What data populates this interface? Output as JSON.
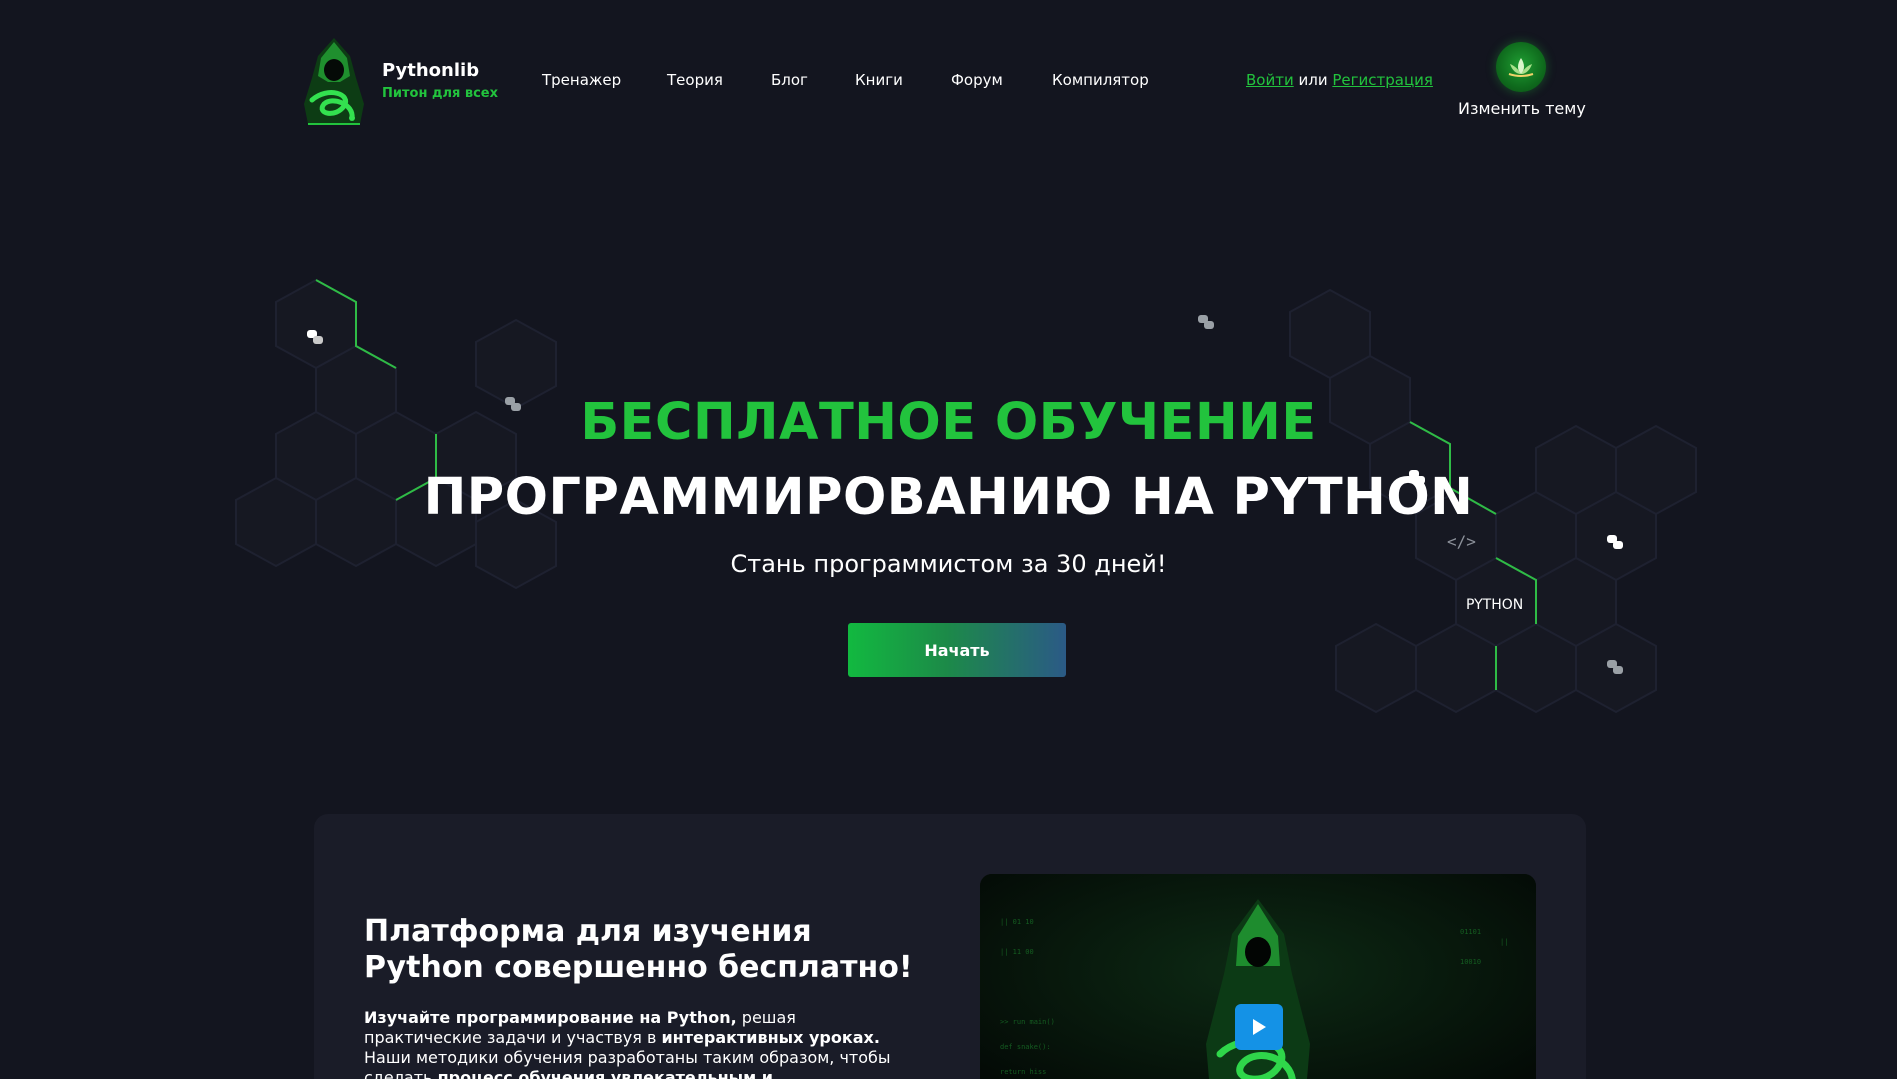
{
  "brand": {
    "name": "Pythonlib",
    "tagline": "Питон для всех",
    "logo_icon": "hooded-snake-hacker-logo"
  },
  "nav": {
    "items": [
      {
        "label": "Тренажер"
      },
      {
        "label": "Теория"
      },
      {
        "label": "Блог"
      },
      {
        "label": "Книги"
      },
      {
        "label": "Форум"
      },
      {
        "label": "Компилятор"
      }
    ]
  },
  "auth": {
    "login": "Войти",
    "or": "или",
    "register": "Регистрация"
  },
  "theme": {
    "label": "Изменить тему",
    "icon": "lotus-icon"
  },
  "hero": {
    "title_line1": "БЕСПЛАТНОЕ ОБУЧЕНИЕ",
    "title_line2": "ПРОГРАММИРОВАНИЮ НА PYTHON",
    "subtitle": "Стань программистом за 30 дней!",
    "cta": "Начать",
    "decor_word": "PYTHON"
  },
  "intro": {
    "title": "Платформа для изучения Python совершенно бесплатно!",
    "p_bold1": "Изучайте программирование на Python,",
    "p_text1": " решая практические задачи и участвуя в ",
    "p_bold2": "интерактивных уроках.",
    "p_text2": " Наши методики обучения разработаны таким образом, чтобы сделать ",
    "p_bold3": "процесс обучения увлекательным и эффективным."
  },
  "colors": {
    "background": "#13151f",
    "accent": "#22c33d",
    "card": "#1a1c28",
    "play": "#1492e6"
  }
}
